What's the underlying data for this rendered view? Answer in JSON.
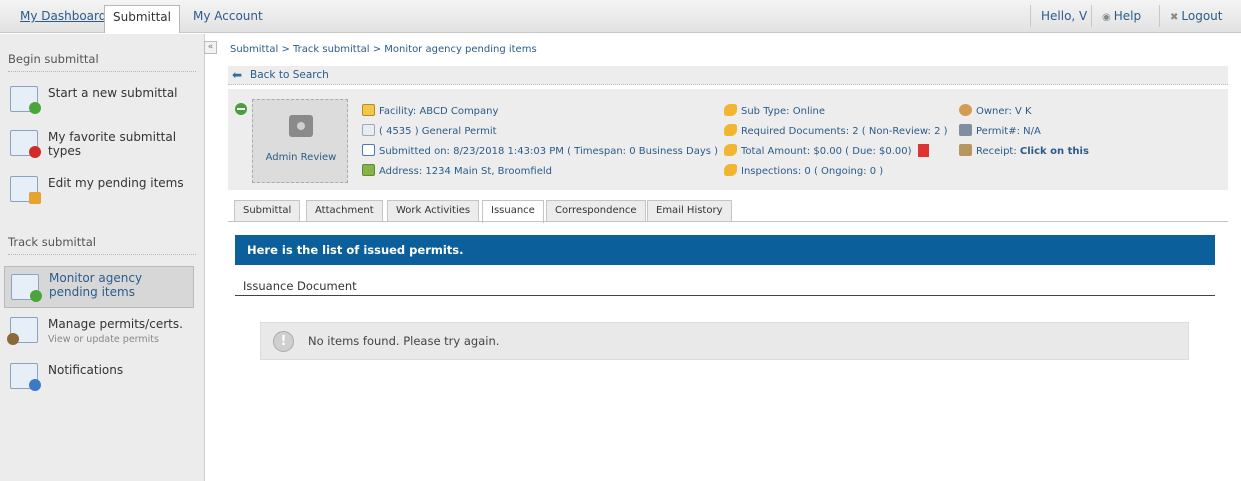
{
  "topbar": {
    "tabs": [
      {
        "label": "My Dashboard"
      },
      {
        "label": "Submittal"
      },
      {
        "label": "My Account"
      }
    ],
    "greeting": "Hello, V",
    "help": "Help",
    "logout": "Logout"
  },
  "sidebar": {
    "begin_title": "Begin submittal",
    "begin_items": [
      {
        "label": "Start a new submittal",
        "icon": "add-submittal-icon"
      },
      {
        "label": "My favorite submittal types",
        "icon": "favorite-submittal-icon"
      },
      {
        "label": "Edit my pending items",
        "icon": "edit-pending-icon"
      }
    ],
    "track_title": "Track submittal",
    "track_items": [
      {
        "label": "Monitor agency pending items",
        "icon": "monitor-pending-icon"
      },
      {
        "label": "Manage permits/certs.",
        "sub": "View or update permits",
        "icon": "manage-permits-icon"
      },
      {
        "label": "Notifications",
        "icon": "notifications-icon"
      }
    ],
    "collapse": "«"
  },
  "breadcrumb": "Submittal > Track submittal > Monitor agency pending items",
  "back_to_search": "Back to Search",
  "info": {
    "status_label": "Admin Review",
    "facility": "Facility: ABCD Company",
    "permit_type": "( 4535 ) General Permit",
    "submitted_on": "Submitted on: 8/23/2018 1:43:03 PM ( Timespan: 0 Business Days )",
    "address": "Address: 1234 Main St, Broomfield",
    "sub_type": "Sub Type: Online",
    "required_docs": "Required Documents: 2 ( Non-Review: 2 )",
    "total_amount": "Total Amount: $0.00 ( Due: $0.00)",
    "inspections": "Inspections: 0 ( Ongoing: 0 )",
    "owner": "Owner: V K",
    "permit_no": "Permit#: N/A",
    "receipt_prefix": "Receipt:",
    "receipt_link": "Click on this"
  },
  "tabs": [
    {
      "label": "Submittal"
    },
    {
      "label": "Attachment"
    },
    {
      "label": "Work Activities"
    },
    {
      "label": "Issuance"
    },
    {
      "label": "Correspondence"
    },
    {
      "label": "Email History"
    }
  ],
  "banner": "Here is the list of issued permits.",
  "section_header": "Issuance Document",
  "empty_message": "No items found. Please try again.",
  "colors": {
    "banner": "#0b5f9a",
    "link": "#2a5c8a",
    "sidebar_bg": "#ececec"
  }
}
